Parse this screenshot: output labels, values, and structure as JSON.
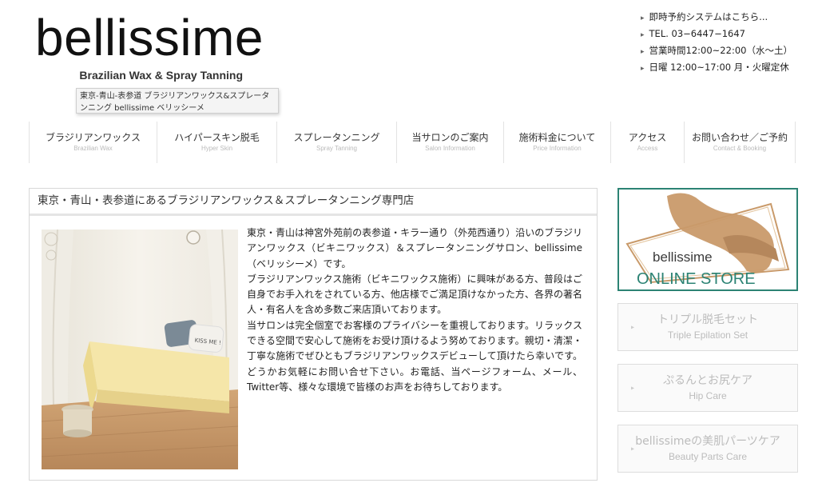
{
  "header": {
    "logo_text": "bellissime",
    "logo_tagline": "Brazilian Wax & Spray Tanning",
    "tooltip_text": "東京-青山-表参道 ブラジリアンワックス&スプレータンニング bellissime ベリッシーメ",
    "info_lines": [
      "即時予約システムはこちら...",
      "TEL. 03−6447−1647",
      "営業時間12:00~22:00（水〜土）",
      "日曜 12:00~17:00 月・火曜定休"
    ]
  },
  "nav": [
    {
      "jp": "ブラジリアンワックス",
      "en": "Brazilian Wax"
    },
    {
      "jp": "ハイパースキン脱毛",
      "en": "Hyper Skin"
    },
    {
      "jp": "スプレータンニング",
      "en": "Spray Tanning"
    },
    {
      "jp": "当サロンのご案内",
      "en": "Salon Information"
    },
    {
      "jp": "施術料金について",
      "en": "Price Information"
    },
    {
      "jp": "アクセス",
      "en": "Access"
    },
    {
      "jp": "お問い合わせ／ご予約",
      "en": "Contact & Booking"
    }
  ],
  "main": {
    "title": "東京・青山・表参道にあるブラジリアンワックス＆スプレータンニング専門店",
    "photo_pillow_text": "KISS ME !",
    "body": "東京・青山は神宮外苑前の表参道・キラー通り（外苑西通り）沿いのブラジリアンワックス（ビキニワックス）＆スプレータンニングサロン、bellissime（ベリッシーメ）です。\nブラジリアンワックス施術（ビキニワックス施術）に興味がある方、普段はご自身でお手入れをされている方、他店様でご満足頂けなかった方、各界の著名人・有名人を含め多数ご来店頂いております。\n当サロンは完全個室でお客様のプライバシーを重視しております。リラックスできる空間で安心して施術をお受け頂けるよう努めております。親切・清潔・丁寧な施術でぜひともブラジリアンワックスデビューして頂けたら幸いです。どうかお気軽にお問い合せ下さい。お電話、当ページフォーム、メール、Twitter等、様々な環境で皆様のお声をお待ちしております。"
  },
  "sidebar": {
    "online_store": {
      "brand": "bellissime",
      "label": "ONLINE STORE"
    },
    "buttons": [
      {
        "jp": "トリプル脱毛セット",
        "en": "Triple Epilation Set"
      },
      {
        "jp": "ぷるんとお尻ケア",
        "en": "Hip Care"
      },
      {
        "jp": "bellissimeの美肌パーツケア",
        "en": "Beauty Parts Care"
      }
    ]
  },
  "colors": {
    "store_accent": "#2c8374",
    "store_figure": "#c99a6a",
    "nav_divider": "#e3e3e3"
  }
}
